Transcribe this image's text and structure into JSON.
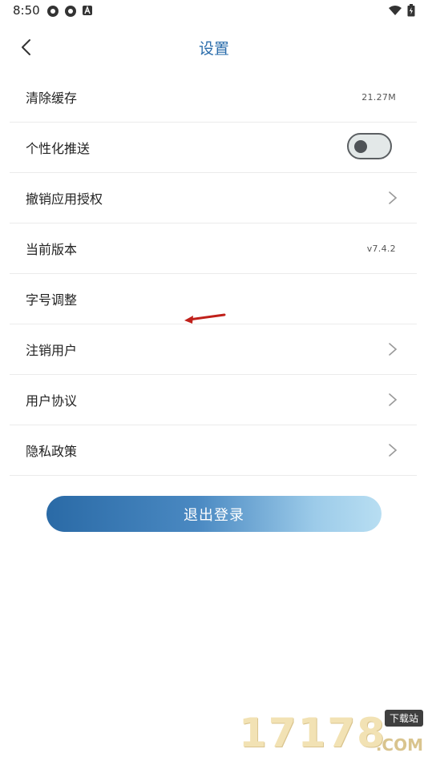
{
  "status_bar": {
    "time": "8:50"
  },
  "header": {
    "title": "设置"
  },
  "settings": {
    "items": [
      {
        "label": "清除缓存",
        "value": "21.27M"
      },
      {
        "label": "个性化推送"
      },
      {
        "label": "撤销应用授权"
      },
      {
        "label": "当前版本",
        "value": "v7.4.2"
      },
      {
        "label": "字号调整"
      },
      {
        "label": "注销用户"
      },
      {
        "label": "用户协议"
      },
      {
        "label": "隐私政策"
      }
    ],
    "push_toggle": {
      "enabled": false
    }
  },
  "logout_label": "退出登录",
  "watermark": {
    "main": "17178",
    "sub_top": "下载站",
    "sub_bottom": ".COM"
  },
  "colors": {
    "accent": "#2a6cab",
    "divider": "#ebebeb"
  }
}
